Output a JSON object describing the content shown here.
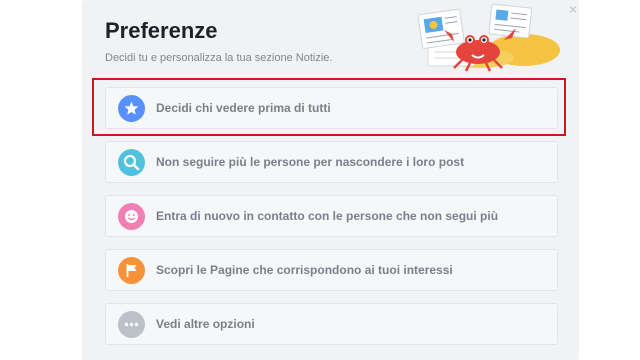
{
  "dialog": {
    "title": "Preferenze",
    "subtitle": "Decidi tu e personalizza la tua sezione Notizie.",
    "close_symbol": "×"
  },
  "options": [
    {
      "label": "Decidi chi vedere prima di tutti",
      "icon": "star-icon",
      "color": "#5890ff"
    },
    {
      "label": "Non seguire più le persone per nascondere i loro post",
      "icon": "search-icon",
      "color": "#4fc3dd"
    },
    {
      "label": "Entra di nuovo in contatto con le persone che non segui più",
      "icon": "smile-icon",
      "color": "#f17fb3"
    },
    {
      "label": "Scopri le Pagine che corrispondono ai tuoi interessi",
      "icon": "flag-icon",
      "color": "#f7923b"
    },
    {
      "label": "Vedi altre opzioni",
      "icon": "more-icon",
      "color": "#bcc0c8"
    }
  ],
  "highlight_color": "#d0161b"
}
